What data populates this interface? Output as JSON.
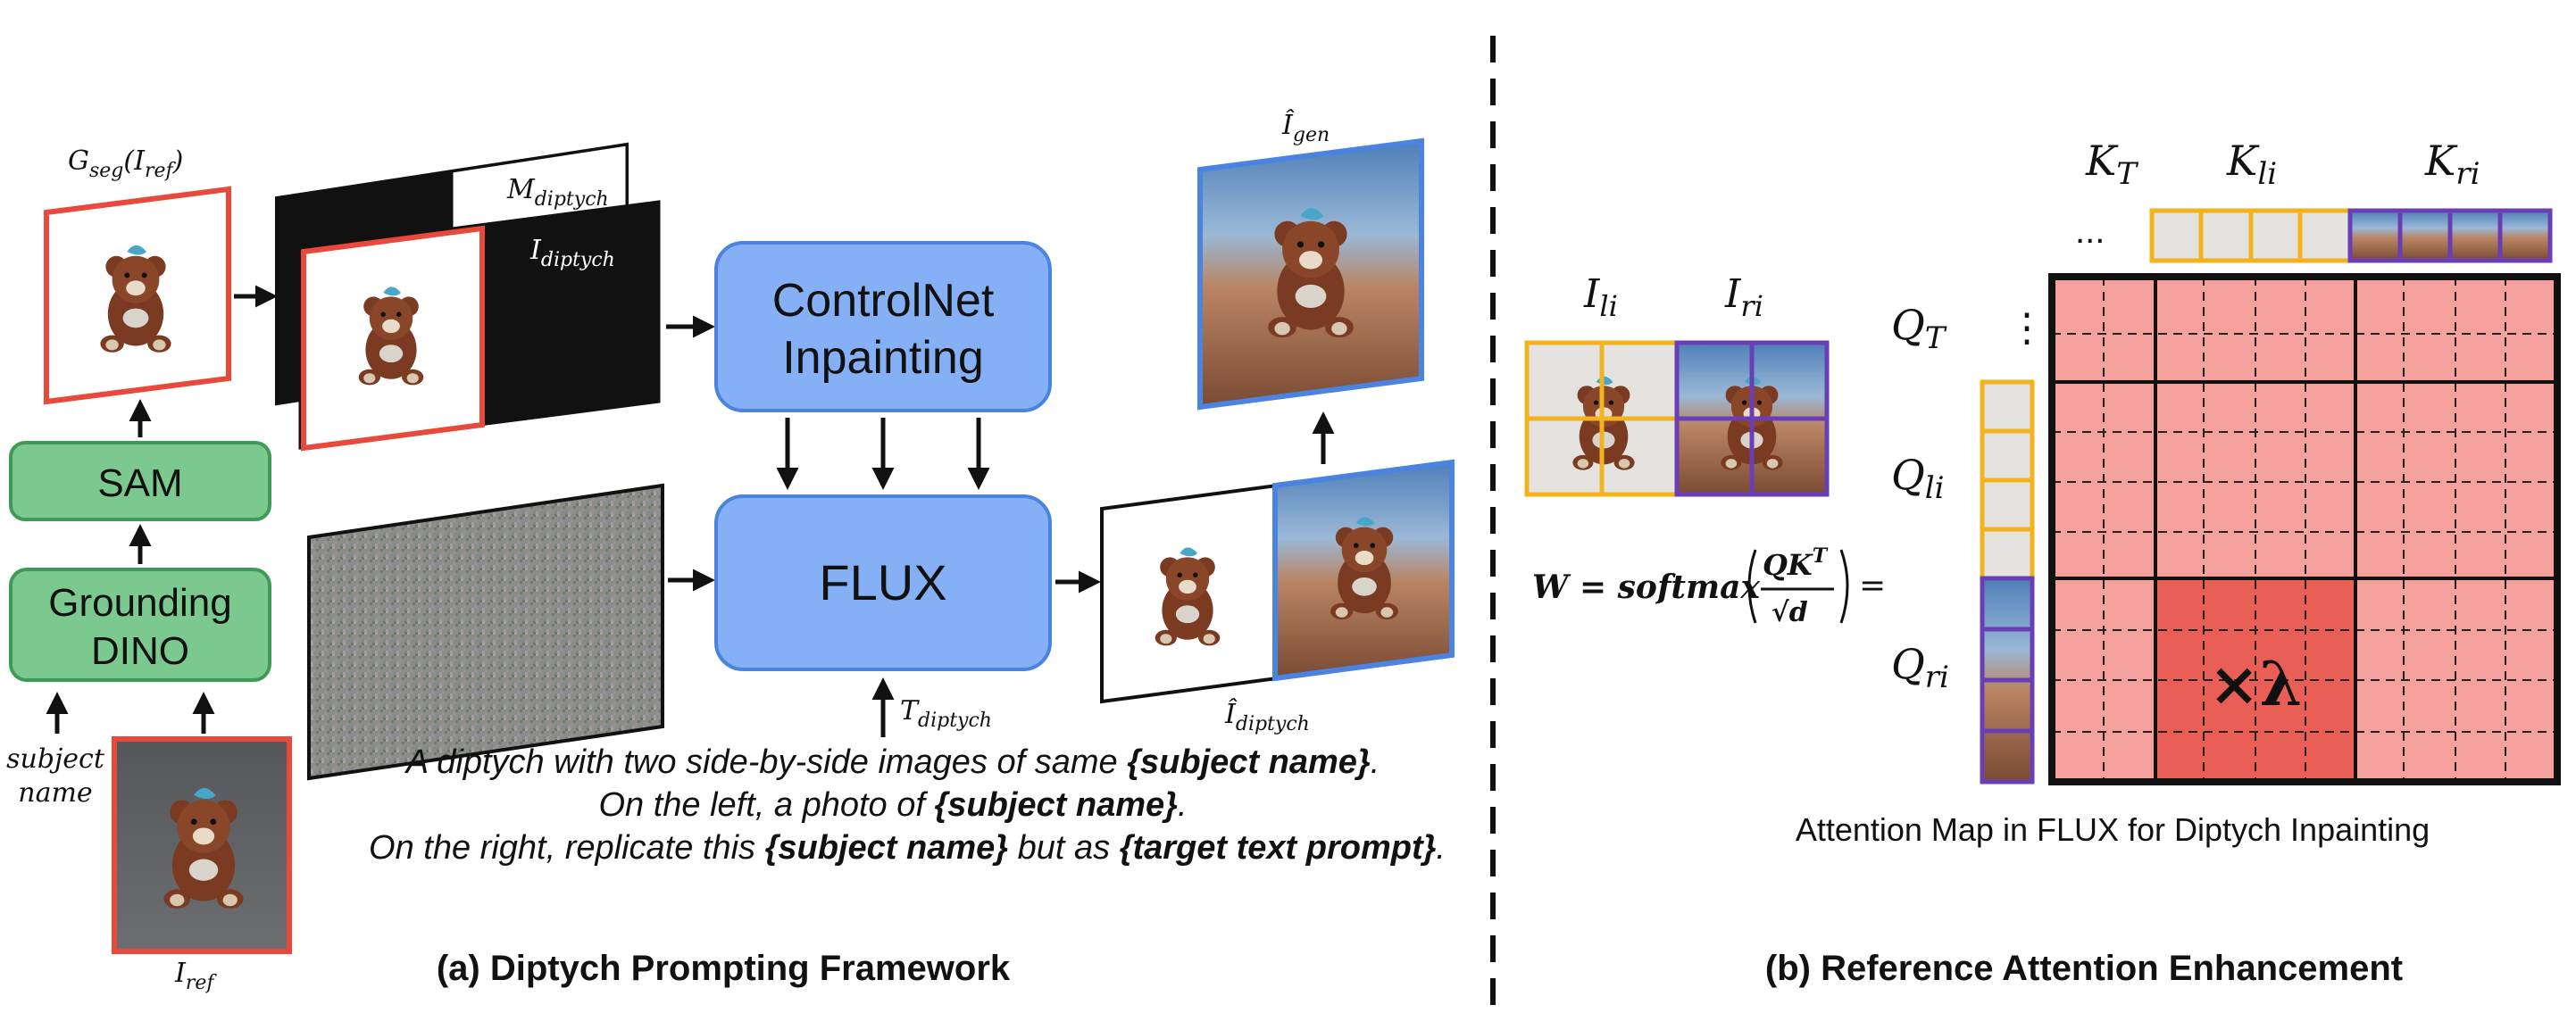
{
  "left_panel": {
    "caption": "(a) Diptych Prompting Framework",
    "labels": {
      "g_seg": "G",
      "g_seg_sub": "seg",
      "g_seg_arg": "(I",
      "g_seg_arg_sub": "ref",
      "g_seg_close": ")",
      "m_diptych": "M",
      "m_diptych_sub": "diptych",
      "i_diptych": "I",
      "i_diptych_sub": "diptych",
      "i_gen": "Î",
      "i_gen_sub": "gen",
      "i_diptych_hat": "Î",
      "i_diptych_hat_sub": "diptych",
      "t_diptych": "T",
      "t_diptych_sub": "diptych",
      "i_ref": "I",
      "i_ref_sub": "ref",
      "subject_name_1": "subject",
      "subject_name_2": "name"
    },
    "boxes": {
      "sam": "SAM",
      "grounding_1": "Grounding",
      "grounding_2": "DINO",
      "controlnet_1": "ControlNet",
      "controlnet_2": "Inpainting",
      "flux": "FLUX"
    },
    "prompt": {
      "line1_a": "A diptych with two side-by-side images of same ",
      "line1_b": "{subject name}",
      "line1_c": ".",
      "line2_a": "On the left, a photo of ",
      "line2_b": "{subject name}",
      "line2_c": ".",
      "line3_a": "On the right, replicate this ",
      "line3_b": "{subject name}",
      "line3_c": " but as ",
      "line3_d": "{target text prompt}",
      "line3_e": "."
    }
  },
  "right_panel": {
    "caption": "(b) Reference Attention Enhancement",
    "map_caption": "Attention Map in FLUX for Diptych Inpainting",
    "labels": {
      "i_li": "I",
      "i_li_sub": "li",
      "i_ri": "I",
      "i_ri_sub": "ri",
      "k_t": "K",
      "k_t_sub": "T",
      "k_li": "K",
      "k_li_sub": "li",
      "k_ri": "K",
      "k_ri_sub": "ri",
      "q_t": "Q",
      "q_t_sub": "T",
      "q_li": "Q",
      "q_li_sub": "li",
      "q_ri": "Q",
      "q_ri_sub": "ri",
      "ellipsis_h": "...",
      "ellipsis_v": "⋮",
      "lambda": "×λ"
    },
    "formula": {
      "lhs": "W = softmax",
      "num": "QK",
      "num_sup": "T",
      "den": "√d",
      "eq": "="
    }
  },
  "colors": {
    "red_border": "#e8493b",
    "green_fill": "#7cc98f",
    "green_stroke": "#3f9a58",
    "blue_fill": "#86b0f5",
    "blue_stroke": "#4a83e0",
    "gold": "#f2b31f",
    "purple": "#6a3fb5",
    "pink_cell": "#f4a09d",
    "pink_hot": "#ea5f55"
  }
}
